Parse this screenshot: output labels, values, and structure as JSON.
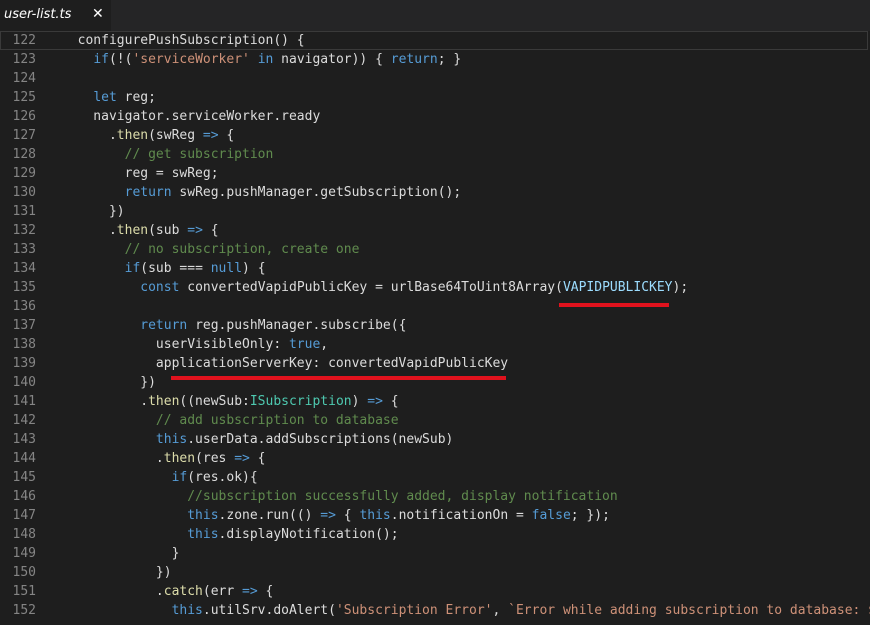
{
  "tab": {
    "filename": "user-list.ts",
    "close_glyph": "✕"
  },
  "colors": {
    "background": "#1e1e1e",
    "keyword": "#569cd6",
    "string": "#ce9178",
    "comment": "#608b4e",
    "function": "#dcdcaa",
    "variable": "#9cdcfe",
    "type": "#4ec9b0",
    "line_number": "#858585",
    "highlight_underline": "#e0121d"
  },
  "lines": [
    {
      "n": "122",
      "t": [
        [
          "plain",
          "  configurePushSubscription() {"
        ]
      ]
    },
    {
      "n": "123",
      "t": [
        [
          "plain",
          "    "
        ],
        [
          "kw",
          "if"
        ],
        [
          "plain",
          "(!("
        ],
        [
          "str",
          "'serviceWorker'"
        ],
        [
          "plain",
          " "
        ],
        [
          "kw",
          "in"
        ],
        [
          "plain",
          " navigator)) { "
        ],
        [
          "kw",
          "return"
        ],
        [
          "plain",
          "; }"
        ]
      ]
    },
    {
      "n": "124",
      "t": []
    },
    {
      "n": "125",
      "t": [
        [
          "plain",
          "    "
        ],
        [
          "kw",
          "let"
        ],
        [
          "plain",
          " reg;"
        ]
      ]
    },
    {
      "n": "126",
      "t": [
        [
          "plain",
          "    navigator.serviceWorker.ready"
        ]
      ]
    },
    {
      "n": "127",
      "t": [
        [
          "plain",
          "      ."
        ],
        [
          "fn",
          "then"
        ],
        [
          "plain",
          "(swReg "
        ],
        [
          "kw",
          "=>"
        ],
        [
          "plain",
          " {"
        ]
      ]
    },
    {
      "n": "128",
      "t": [
        [
          "cmt",
          "        // get subscription"
        ]
      ]
    },
    {
      "n": "129",
      "t": [
        [
          "plain",
          "        reg = swReg;"
        ]
      ]
    },
    {
      "n": "130",
      "t": [
        [
          "plain",
          "        "
        ],
        [
          "kw",
          "return"
        ],
        [
          "plain",
          " swReg.pushManager.getSubscription();"
        ]
      ]
    },
    {
      "n": "131",
      "t": [
        [
          "plain",
          "      })"
        ]
      ]
    },
    {
      "n": "132",
      "t": [
        [
          "plain",
          "      ."
        ],
        [
          "fn",
          "then"
        ],
        [
          "plain",
          "(sub "
        ],
        [
          "kw",
          "=>"
        ],
        [
          "plain",
          " {"
        ]
      ]
    },
    {
      "n": "133",
      "t": [
        [
          "cmt",
          "        // no subscription, create one"
        ]
      ]
    },
    {
      "n": "134",
      "t": [
        [
          "plain",
          "        "
        ],
        [
          "kw",
          "if"
        ],
        [
          "plain",
          "(sub === "
        ],
        [
          "kw",
          "null"
        ],
        [
          "plain",
          ") {"
        ]
      ]
    },
    {
      "n": "135",
      "t": [
        [
          "plain",
          "          "
        ],
        [
          "kw",
          "const"
        ],
        [
          "plain",
          " convertedVapidPublicKey = urlBase64ToUint8Array("
        ],
        [
          "var",
          "VAPIDPUBLICKEY"
        ],
        [
          "plain",
          ");"
        ]
      ]
    },
    {
      "n": "136",
      "t": []
    },
    {
      "n": "137",
      "t": [
        [
          "plain",
          "          "
        ],
        [
          "kw",
          "return"
        ],
        [
          "plain",
          " reg.pushManager.subscribe({"
        ]
      ]
    },
    {
      "n": "138",
      "t": [
        [
          "plain",
          "            userVisibleOnly: "
        ],
        [
          "kw",
          "true"
        ],
        [
          "plain",
          ","
        ]
      ]
    },
    {
      "n": "139",
      "t": [
        [
          "plain",
          "            applicationServerKey: convertedVapidPublicKey"
        ]
      ]
    },
    {
      "n": "140",
      "t": [
        [
          "plain",
          "          })"
        ]
      ]
    },
    {
      "n": "141",
      "t": [
        [
          "plain",
          "          ."
        ],
        [
          "fn",
          "then"
        ],
        [
          "plain",
          "((newSub:"
        ],
        [
          "type",
          "ISubscription"
        ],
        [
          "plain",
          ") "
        ],
        [
          "kw",
          "=>"
        ],
        [
          "plain",
          " {"
        ]
      ]
    },
    {
      "n": "142",
      "t": [
        [
          "cmt",
          "            // add usbscription to database"
        ]
      ]
    },
    {
      "n": "143",
      "t": [
        [
          "plain",
          "            "
        ],
        [
          "kw",
          "this"
        ],
        [
          "plain",
          ".userData.addSubscriptions(newSub)"
        ]
      ]
    },
    {
      "n": "144",
      "t": [
        [
          "plain",
          "            ."
        ],
        [
          "fn",
          "then"
        ],
        [
          "plain",
          "(res "
        ],
        [
          "kw",
          "=>"
        ],
        [
          "plain",
          " {"
        ]
      ]
    },
    {
      "n": "145",
      "t": [
        [
          "plain",
          "              "
        ],
        [
          "kw",
          "if"
        ],
        [
          "plain",
          "(res.ok){"
        ]
      ]
    },
    {
      "n": "146",
      "t": [
        [
          "cmt",
          "                //subscription successfully added, display notification"
        ]
      ]
    },
    {
      "n": "147",
      "t": [
        [
          "plain",
          "                "
        ],
        [
          "kw",
          "this"
        ],
        [
          "plain",
          ".zone.run(() "
        ],
        [
          "kw",
          "=>"
        ],
        [
          "plain",
          " { "
        ],
        [
          "kw",
          "this"
        ],
        [
          "plain",
          ".notificationOn = "
        ],
        [
          "kw",
          "false"
        ],
        [
          "plain",
          "; });"
        ]
      ]
    },
    {
      "n": "148",
      "t": [
        [
          "plain",
          "                "
        ],
        [
          "kw",
          "this"
        ],
        [
          "plain",
          ".displayNotification();"
        ]
      ]
    },
    {
      "n": "149",
      "t": [
        [
          "plain",
          "              }"
        ]
      ]
    },
    {
      "n": "150",
      "t": [
        [
          "plain",
          "            })"
        ]
      ]
    },
    {
      "n": "151",
      "t": [
        [
          "plain",
          "            ."
        ],
        [
          "fn",
          "catch"
        ],
        [
          "plain",
          "(err "
        ],
        [
          "kw",
          "=>"
        ],
        [
          "plain",
          " {"
        ]
      ]
    },
    {
      "n": "152",
      "t": [
        [
          "plain",
          "              "
        ],
        [
          "kw",
          "this"
        ],
        [
          "plain",
          ".utilSrv.doAlert("
        ],
        [
          "str",
          "'Subscription Error'"
        ],
        [
          "plain",
          ", "
        ],
        [
          "str",
          "`Error while adding subscription to database: ${"
        ]
      ]
    }
  ]
}
